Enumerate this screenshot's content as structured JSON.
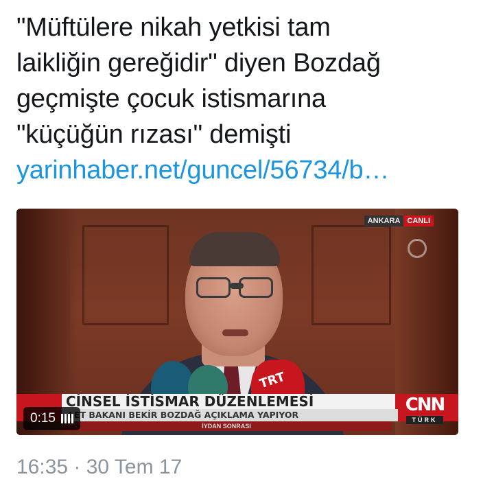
{
  "tweet": {
    "text_lines": [
      "\"Müftülere nikah yetkisi tam",
      "laikliğin gereğidir\" diyen Bozdağ",
      "geçmişte çocuk istismarına",
      "\"küçüğün rızası\" demişti"
    ],
    "link": "yarinhaber.net/guncel/56734/b…"
  },
  "media": {
    "live_badge": {
      "place": "ANKARA",
      "live": "CANLI"
    },
    "ticker": {
      "headline": "CİNSEL İSTİSMAR DÜZENLEMESİ",
      "subline": "LET BAKANI BEKİR BOZDAĞ AÇIKLAMA YAPIYOR",
      "strip": "İYDAN SONRASI"
    },
    "mic_label": "TRT",
    "channel_logo": {
      "name": "CNN",
      "sub": "TÜRK"
    },
    "duration": "0:15"
  },
  "timestamp": "16:35 · 30 Tem 17",
  "colors": {
    "link": "#1b95e0",
    "text": "#14171a",
    "meta": "#8a949e",
    "ticker_red": "#c8161e"
  }
}
